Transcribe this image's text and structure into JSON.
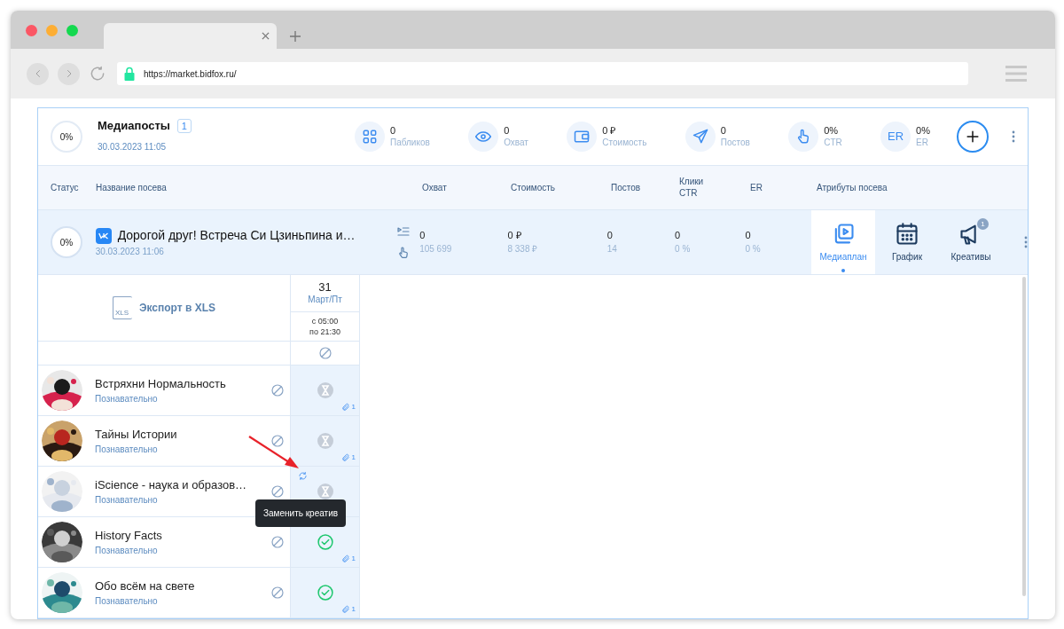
{
  "browser": {
    "url": "https://market.bidfox.ru/"
  },
  "header": {
    "progress": "0%",
    "title": "Медиапосты",
    "count": "1",
    "date": "30.03.2023 11:05",
    "stats": [
      {
        "kind": "grid",
        "value": "0",
        "label": "Пабликов"
      },
      {
        "kind": "eye",
        "value": "0",
        "label": "Охват"
      },
      {
        "kind": "wallet",
        "value": "0 ₽",
        "label": "Стоимость"
      },
      {
        "kind": "send",
        "value": "0",
        "label": "Постов"
      },
      {
        "kind": "hand",
        "value": "0%",
        "label": "CTR"
      },
      {
        "kind": "text",
        "icon_text": "ER",
        "value": "0%",
        "label": "ER"
      }
    ]
  },
  "table": {
    "columns": [
      "Статус",
      "Название посева",
      "Охват",
      "Стоимость",
      "Постов",
      "Клики CTR",
      "ER",
      "Атрибуты посева"
    ]
  },
  "campaign": {
    "progress": "0%",
    "title": "Дорогой друг! Встреча Си Цзиньпина и…",
    "date": "30.03.2023 11:06",
    "metrics": [
      {
        "value": "0",
        "sub": "105 699"
      },
      {
        "value": "0 ₽",
        "sub": "8 338 ₽"
      },
      {
        "value": "0",
        "sub": "14"
      },
      {
        "value": "0",
        "sub": "0 %"
      },
      {
        "value": "0",
        "sub": "0 %"
      }
    ],
    "attributes": [
      {
        "kind": "mediaplan",
        "label": "Медиаплан",
        "selected": true
      },
      {
        "kind": "calendar",
        "label": "График",
        "selected": false
      },
      {
        "kind": "megaphone",
        "label": "Креативы",
        "selected": false,
        "badge": "1"
      }
    ]
  },
  "export": {
    "label": "Экспорт в XLS",
    "file_icon_text": "XLS"
  },
  "day": {
    "number": "31",
    "weekday": "Март/Пт",
    "from": "с 05:00",
    "to": "по 21:30"
  },
  "channels": [
    {
      "name": "Встряхни Нормальность",
      "category": "Познавательно",
      "kind": "pending",
      "attachments": "1",
      "hover": false
    },
    {
      "name": "Тайны Истории",
      "category": "Познавательно",
      "kind": "pending",
      "attachments": "1",
      "hover": false
    },
    {
      "name": "iScience - наука и образов…",
      "category": "Познавательно",
      "kind": "pending",
      "hover": true
    },
    {
      "name": "History Facts",
      "category": "Познавательно",
      "kind": "done",
      "attachments": "1",
      "hover": false
    },
    {
      "name": "Обо всём на свете",
      "category": "Познавательно",
      "kind": "done",
      "attachments": "1",
      "hover": false
    }
  ],
  "tooltip": {
    "text": "Заменить креатив"
  }
}
